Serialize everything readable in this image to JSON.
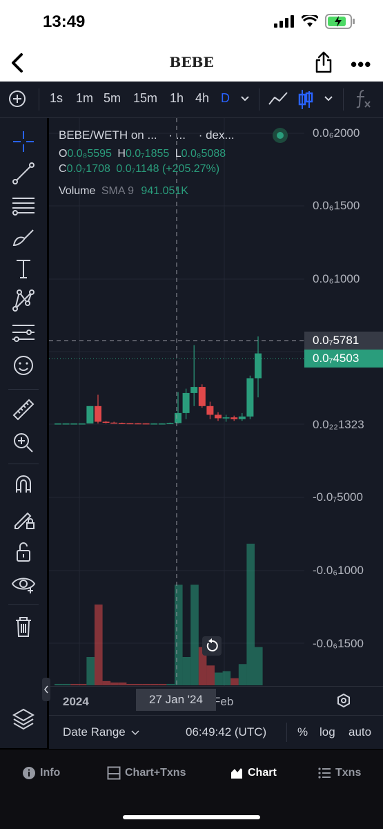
{
  "status": {
    "time": "13:49"
  },
  "nav": {
    "title": "BEBE"
  },
  "toolbar": {
    "intervals": [
      "1s",
      "1m",
      "5m",
      "15m",
      "1h",
      "4h",
      "D"
    ],
    "active_interval": "D"
  },
  "legend": {
    "title": "BEBE/WETH on ...",
    "dots1": "· ...",
    "source": "· dex...",
    "ohlc": {
      "o_label": "O",
      "o_value": "0.0₈5595",
      "h_label": "H",
      "h_value": "0.0₇1855",
      "l_label": "L",
      "l_value": "0.0₈5088",
      "c_label": "C",
      "c_value": "0.0₇1708",
      "change_value": "0.0₇1148",
      "change_pct": "(+205.27%)"
    },
    "volume_label": "Volume",
    "volume_sma": "SMA 9",
    "volume_value": "941.051K"
  },
  "price_axis": {
    "labels": [
      "0.0₆2000",
      "0.0₆1500",
      "0.0₆1000",
      "0.0₂₂1323",
      "-0.0₇5000",
      "-0.0₆1000",
      "-0.0₆1500"
    ],
    "crosshair_price": "0.0₇5781",
    "last_price": "0.0₇4503"
  },
  "time_axis": {
    "year": "2024",
    "crosshair_date": "27 Jan '24",
    "month": "Feb"
  },
  "bottom": {
    "date_range": "Date Range",
    "clock": "06:49:42 (UTC)",
    "percent": "%",
    "log": "log",
    "auto": "auto"
  },
  "tabs": [
    {
      "label": "Info",
      "icon": "info-icon"
    },
    {
      "label": "Chart+Txns",
      "icon": "split-view-icon"
    },
    {
      "label": "Chart",
      "icon": "chart-icon",
      "active": true
    },
    {
      "label": "Txns",
      "icon": "list-icon"
    }
  ],
  "colors": {
    "up": "#2a9d7c",
    "down": "#e0484a",
    "background": "#161a25",
    "accent": "#2962ff"
  },
  "chart_data": {
    "type": "candlestick",
    "candles": [
      {
        "o": 0.0,
        "h": 0.0,
        "l": 0.0,
        "c": 0.0
      },
      {
        "o": 0.0,
        "h": 0.0,
        "l": 0.0,
        "c": 0.0
      },
      {
        "o": 0.0,
        "h": 0.0,
        "l": 0.0,
        "c": 0.0
      },
      {
        "o": 0.0,
        "h": 0.0,
        "l": 0.0,
        "c": 0.0
      },
      {
        "o": 0.0,
        "h": 0.2,
        "l": 0.0,
        "c": 0.2
      },
      {
        "o": 0.2,
        "h": 0.33,
        "l": 0.0,
        "c": 0.02
      },
      {
        "o": 0.02,
        "h": 0.03,
        "l": 0.0,
        "c": 0.01
      },
      {
        "o": 0.01,
        "h": 0.02,
        "l": 0.0,
        "c": 0.005
      },
      {
        "o": 0.005,
        "h": 0.01,
        "l": 0.0,
        "c": 0.003
      },
      {
        "o": 0.003,
        "h": 0.005,
        "l": 0.0,
        "c": 0.002
      },
      {
        "o": 0.002,
        "h": 0.004,
        "l": 0.0,
        "c": 0.001
      },
      {
        "o": 0.001,
        "h": 0.002,
        "l": 0.0,
        "c": 0.0
      },
      {
        "o": 0.0,
        "h": 0.001,
        "l": 0.0,
        "c": 0.0
      },
      {
        "o": 0.0,
        "h": 0.001,
        "l": 0.0,
        "c": 0.0
      },
      {
        "o": 0.0,
        "h": 0.01,
        "l": 0.0,
        "c": 0.005
      },
      {
        "o": 0.005,
        "h": 0.36,
        "l": 0.0,
        "c": 0.12
      },
      {
        "o": 0.12,
        "h": 0.4,
        "l": 0.05,
        "c": 0.35
      },
      {
        "o": 0.35,
        "h": 0.9,
        "l": 0.2,
        "c": 0.42
      },
      {
        "o": 0.42,
        "h": 0.45,
        "l": 0.18,
        "c": 0.2
      },
      {
        "o": 0.2,
        "h": 0.25,
        "l": 0.05,
        "c": 0.1
      },
      {
        "o": 0.1,
        "h": 0.13,
        "l": 0.03,
        "c": 0.06
      },
      {
        "o": 0.06,
        "h": 0.1,
        "l": 0.02,
        "c": 0.07
      },
      {
        "o": 0.07,
        "h": 0.09,
        "l": 0.03,
        "c": 0.05
      },
      {
        "o": 0.05,
        "h": 0.12,
        "l": 0.03,
        "c": 0.08
      },
      {
        "o": 0.08,
        "h": 0.55,
        "l": 0.05,
        "c": 0.52
      },
      {
        "o": 0.52,
        "h": 1.0,
        "l": 0.3,
        "c": 0.805
      }
    ],
    "volumes": [
      0.01,
      0.01,
      0.01,
      0.01,
      0.2,
      0.57,
      0.03,
      0.02,
      0.02,
      0.01,
      0.01,
      0.01,
      0.01,
      0.01,
      0.01,
      0.71,
      0.2,
      0.71,
      0.27,
      0.14,
      0.09,
      0.1,
      0.05,
      0.15,
      1.0,
      0.27
    ],
    "volume_up": [
      true,
      true,
      false,
      false,
      true,
      false,
      false,
      false,
      false,
      false,
      false,
      false,
      false,
      false,
      true,
      true,
      true,
      true,
      false,
      false,
      true,
      true,
      false,
      true,
      true,
      true
    ]
  }
}
